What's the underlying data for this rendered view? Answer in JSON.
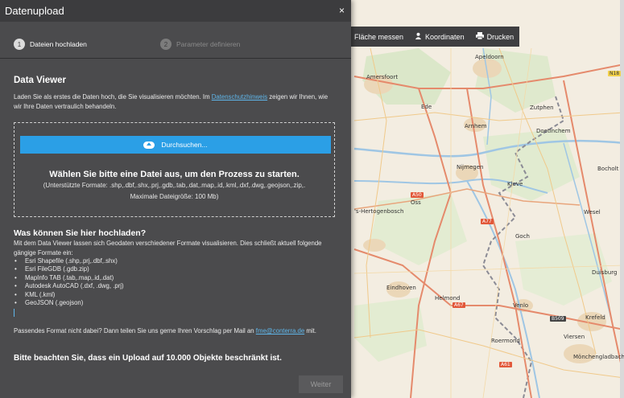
{
  "dialog": {
    "title": "Datenupload",
    "close_label": "×",
    "steps": [
      {
        "number": "1",
        "label": "Dateien hochladen",
        "active": true
      },
      {
        "number": "2",
        "label": "Parameter definieren",
        "active": false
      }
    ],
    "heading": "Data Viewer",
    "intro_before_link": "Laden Sie als erstes die Daten hoch, die Sie visualisieren möchten. Im ",
    "intro_link": "Datenschutzhinweis",
    "intro_after_link": " zeigen wir Ihnen, wie wir Ihre Daten vertraulich behandeln.",
    "dropzone": {
      "button_label": "Durchsuchen...",
      "title": "Wählen Sie bitte eine Datei aus, um den Prozess zu starten.",
      "formats": "(Unterstützte Formate: .shp,.dbf,.shx,.prj,.gdb,.tab,.dat,.map,.id,.kml,.dxf,.dwg,.geojson,.zip,.",
      "max_size": "Maximale Dateigröße: 100 Mb)"
    },
    "what_heading": "Was können Sie hier hochladen?",
    "what_text": "Mit dem Data Viewer lassen sich Geodaten verschiedener Formate visualisieren. Dies schließt aktuell folgende gängige Formate ein:",
    "formats_list": [
      "Esri Shapefile (.shp,.prj,.dbf,.shx)",
      "Esri FileGDB (.gdb.zip)",
      "MapInfo TAB (.tab,.map,.id,.dat)",
      "Autodesk AutoCAD (.dxf, .dwg, .prj)",
      "KML (.kml)",
      "GeoJSON (.geojson)"
    ],
    "suggest_before_link": "Passendes Format nicht dabei? Dann teilen Sie uns gerne Ihren Vorschlag per Mail an ",
    "suggest_link": "fme@conterra.de",
    "suggest_after_link": " mit.",
    "notice": "Bitte beachten Sie, dass ein Upload auf 10.000 Objekte beschränkt ist.",
    "next_label": "Weiter"
  },
  "map_toolbar": {
    "measure_label": "Fläche messen",
    "coords_label": "Koordinaten",
    "print_label": "Drucken",
    "coords_icon": "person-pin-icon",
    "print_icon": "printer-icon"
  },
  "map": {
    "cities": [
      {
        "name": "Apeldoorn"
      },
      {
        "name": "Amersfoort"
      },
      {
        "name": "Ede"
      },
      {
        "name": "Arnhem"
      },
      {
        "name": "Doetinchem"
      },
      {
        "name": "Nijmegen"
      },
      {
        "name": "Kleve"
      },
      {
        "name": "Bocholt"
      },
      {
        "name": "'s-Hertogenbosch"
      },
      {
        "name": "Eindhoven"
      },
      {
        "name": "Venlo"
      },
      {
        "name": "Krefeld"
      },
      {
        "name": "Mönchengladbach"
      },
      {
        "name": "Zutphen"
      },
      {
        "name": "Wesel"
      },
      {
        "name": "Goch"
      },
      {
        "name": "Oss"
      },
      {
        "name": "Helmond"
      },
      {
        "name": "Roermond"
      },
      {
        "name": "Viersen"
      },
      {
        "name": "Duisburg"
      }
    ],
    "roads": [
      "N18",
      "A50",
      "A77",
      "A67",
      "B509",
      "A61"
    ]
  }
}
